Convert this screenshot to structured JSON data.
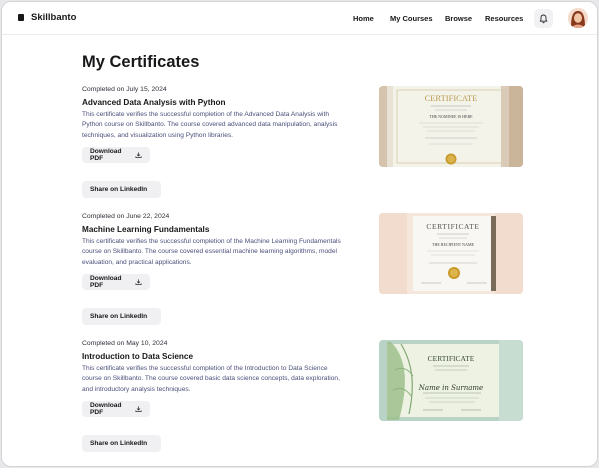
{
  "brand": {
    "name": "Skillbanto"
  },
  "nav": {
    "home": "Home",
    "courses": "My Courses",
    "browse": "Browse",
    "resources": "Resources"
  },
  "icons": {
    "bell": "bell-icon",
    "download": "download-icon",
    "logo": "logo-mark-icon"
  },
  "page": {
    "title": "My Certificates"
  },
  "certificates": [
    {
      "date": "Completed on July 15, 2024",
      "title": "Advanced Data Analysis with Python",
      "desc1": "This certificate verifies the successful completion of the Advanced Data Analysis with",
      "desc2": "Python course on Skillbanto. The course covered advanced data manipulation, analysis",
      "desc3": "techniques, and visualization using Python libraries.",
      "pdf": "Download PDF",
      "linkedin": "Share on LinkedIn",
      "thumb": {
        "heading": "CERTIFICATE",
        "name": "THE NOMINEE IS HERE"
      }
    },
    {
      "date": "Completed on June 22, 2024",
      "title": "Machine Learning Fundamentals",
      "desc1": "This certificate verifies the successful completion of the Machine Learning Fundamentals",
      "desc2": "course on Skillbanto. The course covered essential machine learning algorithms, model",
      "desc3": "evaluation, and practical applications.",
      "pdf": "Download PDF",
      "linkedin": "Share on LinkedIn",
      "thumb": {
        "heading": "CERTIFICATE",
        "name": "THE RECIPIENT NAME"
      }
    },
    {
      "date": "Completed on May 10, 2024",
      "title": "Introduction to Data Science",
      "desc1": "This certificate verifies the successful completion of the Introduction to Data Science",
      "desc2": "course on Skillbanto. The course covered basic data science concepts, data exploration,",
      "desc3": "and introductory analysis techniques.",
      "pdf": "Download PDF",
      "linkedin": "Share on LinkedIn",
      "thumb": {
        "heading": "CERTIFICATE",
        "name": "Name in Surname"
      }
    }
  ]
}
